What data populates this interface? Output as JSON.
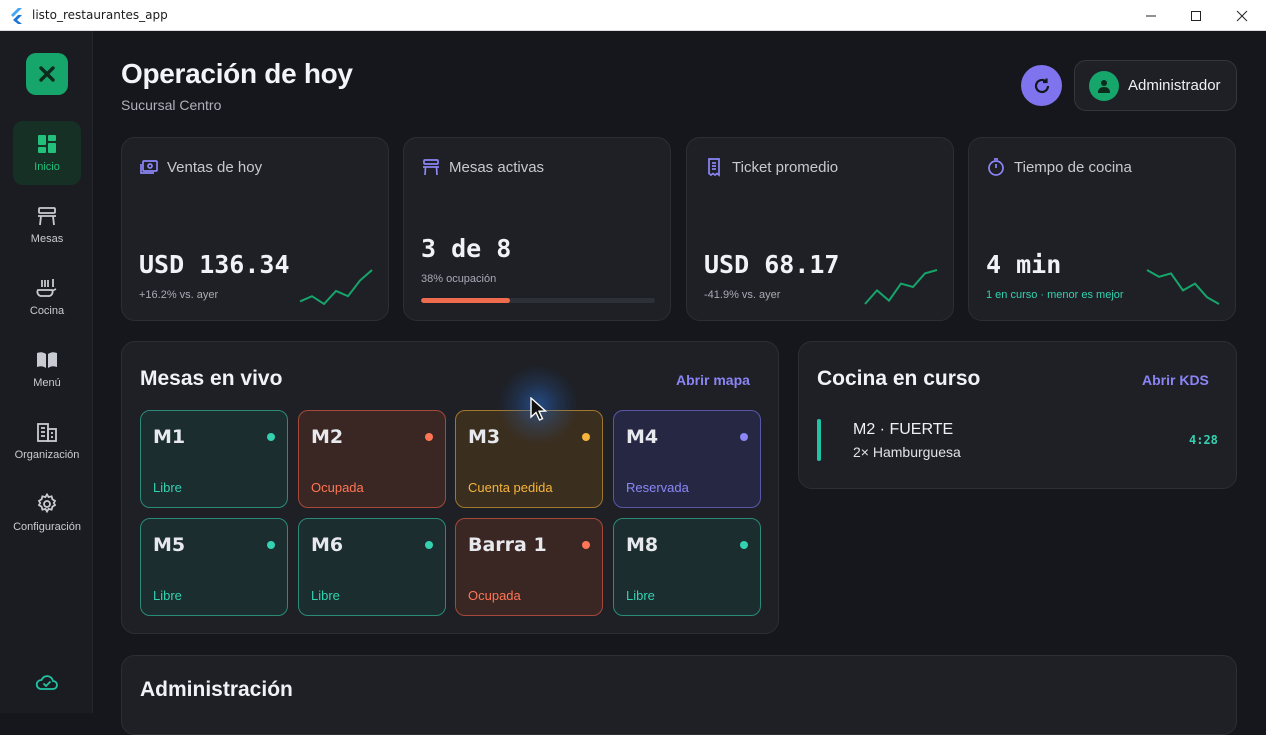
{
  "window": {
    "title": "listo_restaurantes_app"
  },
  "sidebar": {
    "items": [
      {
        "label": "Inicio",
        "icon": "dashboard-icon",
        "active": true
      },
      {
        "label": "Mesas",
        "icon": "table-icon",
        "active": false
      },
      {
        "label": "Cocina",
        "icon": "kitchen-icon",
        "active": false
      },
      {
        "label": "Menú",
        "icon": "book-icon",
        "active": false
      },
      {
        "label": "Organización",
        "icon": "building-icon",
        "active": false
      },
      {
        "label": "Configuración",
        "icon": "gear-icon",
        "active": false
      }
    ]
  },
  "header": {
    "title": "Operación de hoy",
    "subtitle": "Sucursal Centro",
    "user_label": "Administrador"
  },
  "kpis": [
    {
      "label": "Ventas de hoy",
      "value": "USD 136.34",
      "sub": "+16.2% vs. ayer",
      "trend": [
        3,
        5,
        2,
        7,
        5,
        11,
        15
      ]
    },
    {
      "label": "Mesas activas",
      "value": "3 de 8",
      "sub": "38% ocupación",
      "progress": 0.38
    },
    {
      "label": "Ticket promedio",
      "value": "USD 68.17",
      "sub": "-41.9% vs. ayer",
      "trend": [
        2,
        6,
        3,
        8,
        7,
        11,
        12
      ]
    },
    {
      "label": "Tiempo de cocina",
      "value": "4 min",
      "sub": "1 en curso · menor es mejor",
      "trend": [
        12,
        10,
        11,
        6,
        8,
        4,
        2
      ]
    }
  ],
  "live_tables": {
    "title": "Mesas en vivo",
    "link": "Abrir mapa",
    "tables": [
      {
        "name": "M1",
        "status": "Libre",
        "kind": "libre"
      },
      {
        "name": "M2",
        "status": "Ocupada",
        "kind": "ocup"
      },
      {
        "name": "M3",
        "status": "Cuenta pedida",
        "kind": "cuenta"
      },
      {
        "name": "M4",
        "status": "Reservada",
        "kind": "res"
      },
      {
        "name": "M5",
        "status": "Libre",
        "kind": "libre"
      },
      {
        "name": "M6",
        "status": "Libre",
        "kind": "libre"
      },
      {
        "name": "Barra 1",
        "status": "Ocupada",
        "kind": "ocup"
      },
      {
        "name": "M8",
        "status": "Libre",
        "kind": "libre"
      }
    ]
  },
  "kitchen": {
    "title": "Cocina en curso",
    "link": "Abrir KDS",
    "orders": [
      {
        "title": "M2 · FUERTE",
        "items": "2× Hamburguesa",
        "timer": "4:28"
      }
    ]
  },
  "admin_section": {
    "title": "Administración"
  },
  "colors": {
    "brand": "#16a56b",
    "accent": "#7f74ee",
    "libre": "#33d1b0",
    "ocupada": "#ff7656",
    "cuenta": "#f7b53b",
    "reservada": "#8c86f7"
  }
}
